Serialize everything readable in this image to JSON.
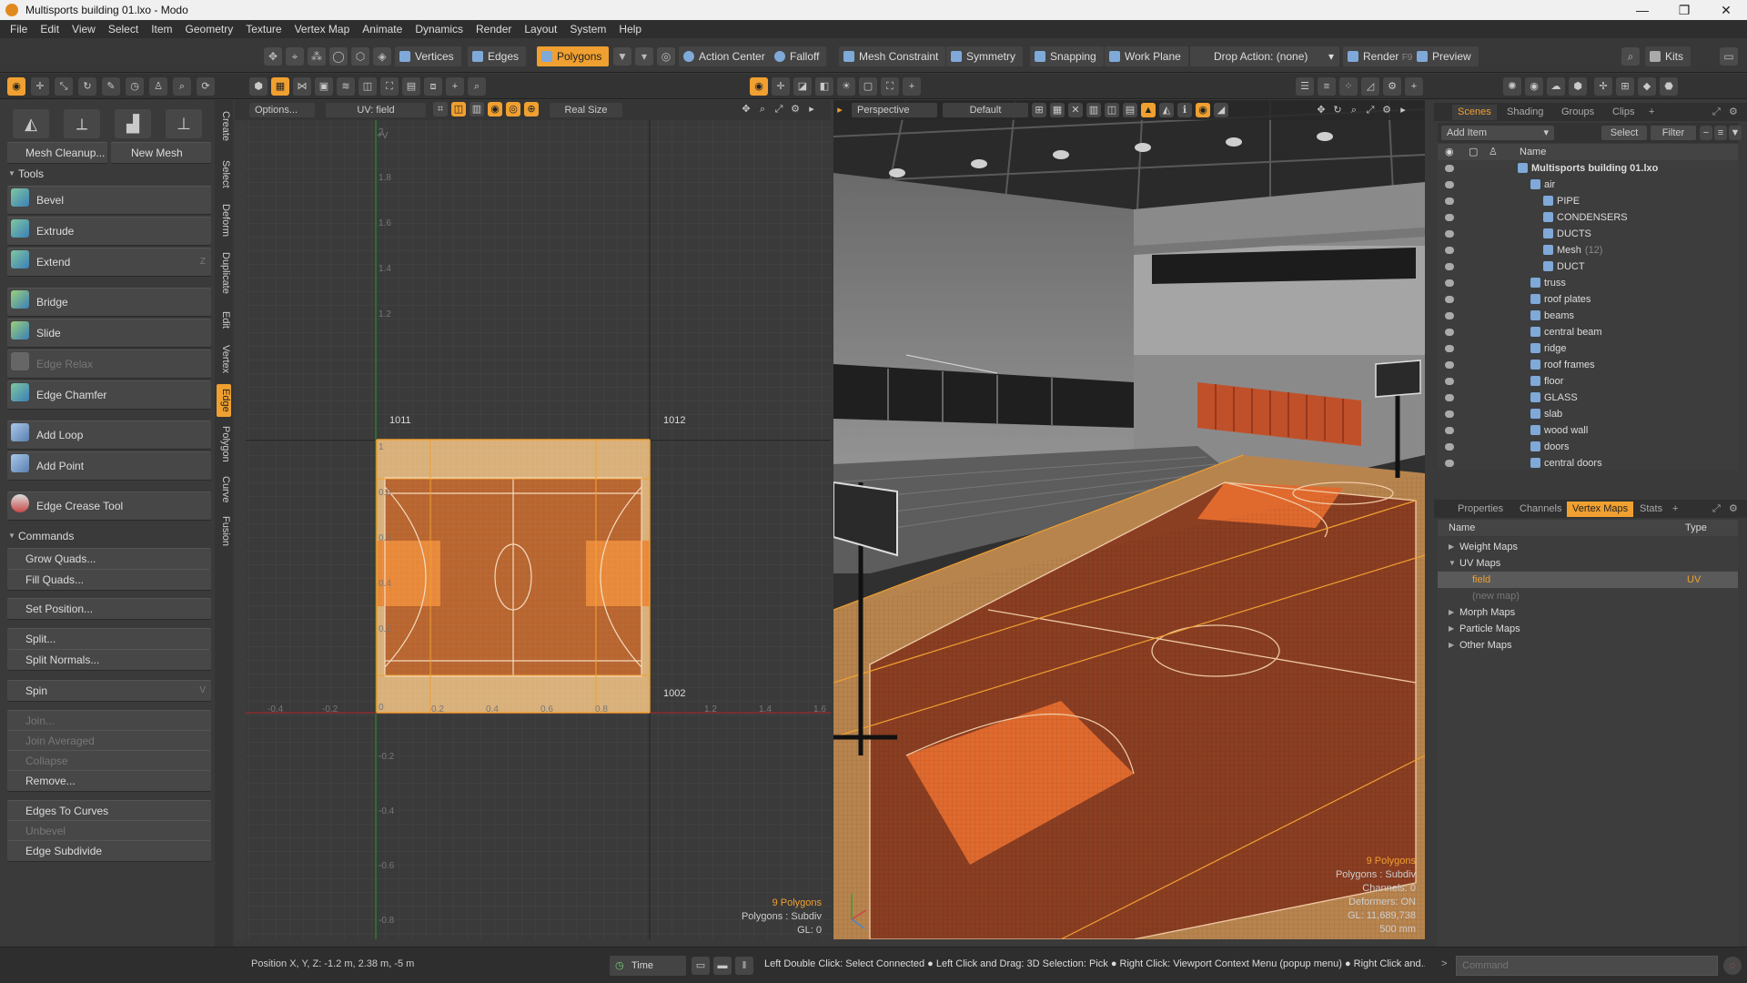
{
  "window": {
    "title": "Multisports building 01.lxo - Modo",
    "controls": [
      "—",
      "❐",
      "✕"
    ]
  },
  "menu": [
    "File",
    "Edit",
    "View",
    "Select",
    "Item",
    "Geometry",
    "Texture",
    "Vertex Map",
    "Animate",
    "Dynamics",
    "Render",
    "Layout",
    "System",
    "Help"
  ],
  "toolbar": {
    "vertices": "Vertices",
    "edges": "Edges",
    "polygons": "Polygons",
    "action_center": "Action Center",
    "falloff": "Falloff",
    "mesh_constraint": "Mesh Constraint",
    "symmetry": "Symmetry",
    "snapping": "Snapping",
    "work_plane": "Work Plane",
    "drop_action": "Drop Action: (none)",
    "render": "Render",
    "render_key": "F9",
    "preview": "Preview",
    "kits": "Kits"
  },
  "left_panel": {
    "mesh_cleanup": "Mesh Cleanup...",
    "new_mesh": "New Mesh",
    "tools_header": "Tools",
    "tools": [
      "Bevel",
      "Extrude",
      "Extend",
      "Bridge",
      "Slide",
      "Edge Relax",
      "Edge Chamfer",
      "Add Loop",
      "Add Point",
      "Edge Crease Tool"
    ],
    "extend_key": "Z",
    "commands_header": "Commands",
    "commands": [
      "Grow Quads...",
      "Fill Quads...",
      "Set Position...",
      "Split...",
      "Split Normals...",
      "Spin",
      "Join...",
      "Join Averaged",
      "Collapse",
      "Remove...",
      "Edges To Curves",
      "Unbevel",
      "Edge Subdivide"
    ],
    "spin_key": "V"
  },
  "vertical_tabs": [
    "Create",
    "Select",
    "Deform",
    "Duplicate",
    "Edit",
    "Vertex",
    "Edge",
    "Polygon",
    "Curve",
    "Fusion"
  ],
  "uv_view": {
    "options": "Options...",
    "uv_label": "UV: field",
    "real_size": "Real Size",
    "axis_v": "+V",
    "tile_labels": [
      "1011",
      "1012",
      "1002"
    ],
    "v_ticks": [
      "2",
      "1.8",
      "1.6",
      "1.4",
      "1.2",
      "1",
      "0.8",
      "0.6",
      "0.4",
      "0.2",
      "0",
      "-0.2",
      "-0.4",
      "-0.6",
      "-0.8"
    ],
    "u_ticks": [
      "-0.4",
      "-0.2",
      "0.2",
      "0.4",
      "0.6",
      "0.8",
      "1.2",
      "1.4",
      "1.6"
    ],
    "info_polygons": "9 Polygons",
    "info_type": "Polygons : Subdiv",
    "info_gl": "GL: 0"
  },
  "viewport3d": {
    "view_label": "Perspective",
    "shading_label": "Default",
    "info_polygons": "9 Polygons",
    "info_type": "Polygons : Subdiv",
    "info_channels": "Channels: 0",
    "info_deformers": "Deformers: ON",
    "info_gl": "GL: 11,689,738",
    "info_size": "500 mm"
  },
  "scene_tabs": [
    "Scenes",
    "Shading",
    "Groups",
    "Clips"
  ],
  "scene_toolbar": {
    "add_item": "Add Item",
    "select": "Select",
    "filter": "Filter"
  },
  "scene_header": "Name",
  "scene_items": [
    {
      "name": "Multisports building 01.lxo",
      "indent": 0
    },
    {
      "name": "air",
      "indent": 1
    },
    {
      "name": "PIPE",
      "indent": 2
    },
    {
      "name": "CONDENSERS",
      "indent": 2
    },
    {
      "name": "DUCTS",
      "indent": 2
    },
    {
      "name": "Mesh",
      "indent": 2,
      "count": "(12)"
    },
    {
      "name": "DUCT",
      "indent": 2
    },
    {
      "name": "truss",
      "indent": 1
    },
    {
      "name": "roof plates",
      "indent": 1
    },
    {
      "name": "beams",
      "indent": 1
    },
    {
      "name": "central beam",
      "indent": 1
    },
    {
      "name": "ridge",
      "indent": 1
    },
    {
      "name": "roof frames",
      "indent": 1
    },
    {
      "name": "floor",
      "indent": 1
    },
    {
      "name": "GLASS",
      "indent": 1
    },
    {
      "name": "slab",
      "indent": 1
    },
    {
      "name": "wood wall",
      "indent": 1
    },
    {
      "name": "doors",
      "indent": 1
    },
    {
      "name": "central doors",
      "indent": 1
    }
  ],
  "props_tabs": [
    "Properties",
    "Channels",
    "Vertex Maps",
    "Stats"
  ],
  "vmap_header": {
    "name": "Name",
    "type": "Type"
  },
  "vmap_items": [
    {
      "name": "Weight Maps",
      "type": ""
    },
    {
      "name": "UV Maps",
      "type": ""
    },
    {
      "name": "field",
      "type": "UV"
    },
    {
      "name": "(new map)",
      "type": ""
    },
    {
      "name": "Morph Maps",
      "type": ""
    },
    {
      "name": "Particle Maps",
      "type": ""
    },
    {
      "name": "Other Maps",
      "type": ""
    }
  ],
  "status": {
    "position": "Position X, Y, Z:   -1.2 m, 2.38 m, -5 m",
    "time": "Time",
    "hint": "Left Double Click: Select Connected ● Left Click and Drag: 3D Selection: Pick ● Right Click: Viewport Context Menu (popup menu) ● Right Click and...",
    "command_placeholder": "Command"
  },
  "colors": {
    "accent": "#f0a030",
    "court": "#b8652f",
    "court_light": "#d9b07a",
    "dark": "#2e2e2e"
  }
}
